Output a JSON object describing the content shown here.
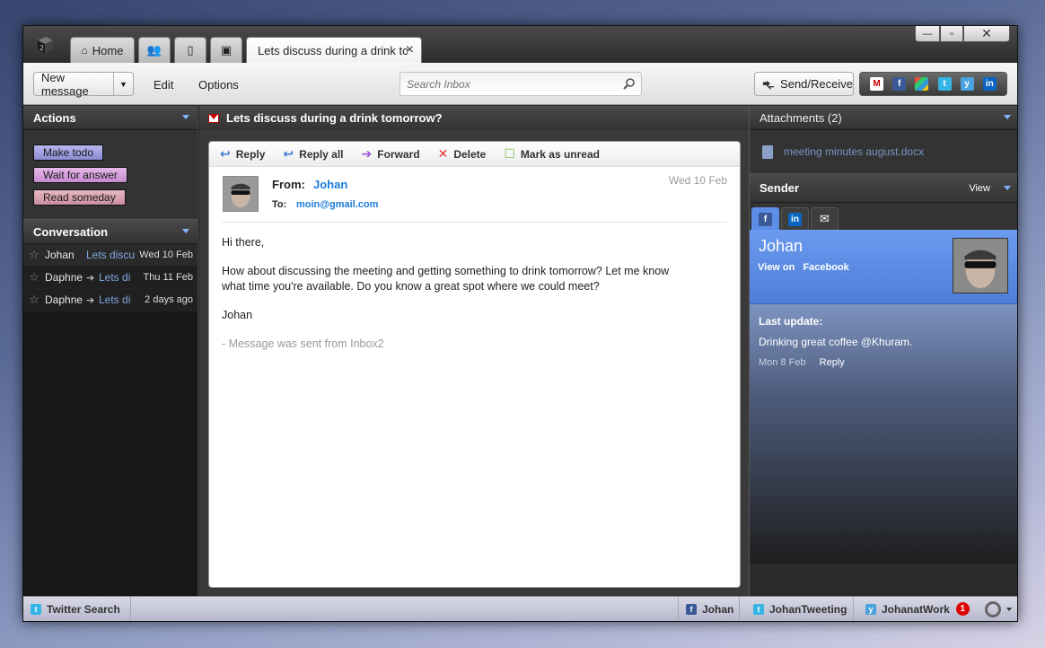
{
  "tabs": {
    "home_label": "Home",
    "active_label": "Lets discuss during a drink tc"
  },
  "window_controls": {
    "minimize": "—",
    "maximize": "▫",
    "close": "✕"
  },
  "toolbar": {
    "new_message": "New message",
    "edit": "Edit",
    "options": "Options",
    "search_placeholder": "Search Inbox",
    "send_receive": "Send/Receive",
    "accounts": [
      "gmail-icon",
      "facebook-icon",
      "windows-live-icon",
      "twitter-icon",
      "yammer-icon",
      "linkedin-icon"
    ]
  },
  "actions": {
    "title": "Actions",
    "tags": [
      "Make todo",
      "Wait for answer",
      "Read someday"
    ]
  },
  "conversation": {
    "title": "Conversation",
    "rows": [
      {
        "name": "Johan",
        "subject": "Lets discu",
        "date": "Wed 10 Feb"
      },
      {
        "name": "Daphne",
        "subject": "Lets di",
        "date": "Thu 11 Feb"
      },
      {
        "name": "Daphne",
        "subject": "Lets di",
        "date": "2 days ago"
      }
    ]
  },
  "message": {
    "subject": "Lets discuss during a drink tomorrow?",
    "actions": [
      "Reply",
      "Reply all",
      "Forward",
      "Delete",
      "Mark as unread"
    ],
    "from_label": "From:",
    "from": "Johan",
    "to_label": "To:",
    "to": "moin@gmail.com",
    "date": "Wed 10 Feb",
    "body": [
      "Hi there,",
      "How about discussing the meeting and getting something to drink tomorrow? Let me know what time you're available. Do you know a great spot where we could meet?",
      "Johan"
    ],
    "signature": "- Message was sent from Inbox2"
  },
  "attachments": {
    "title": "Attachments (2)",
    "file": "meeting minutes august.docx"
  },
  "sender": {
    "title": "Sender",
    "view": "View",
    "name": "Johan",
    "view_on": "View on",
    "network": "Facebook",
    "last_update_label": "Last update:",
    "last_update_text": "Drinking great coffee @Khuram.",
    "last_update_date": "Mon 8 Feb",
    "reply": "Reply"
  },
  "statusbar": {
    "twitter_search": "Twitter Search",
    "johan": "Johan",
    "johan_tweeting": "JohanTweeting",
    "johan_at_work": "JohanatWork",
    "badge": "1"
  },
  "colors": {
    "accent_blue": "#1a7bd8",
    "facebook_blue": "#5c8ee8",
    "badge_red": "#dd0000"
  }
}
